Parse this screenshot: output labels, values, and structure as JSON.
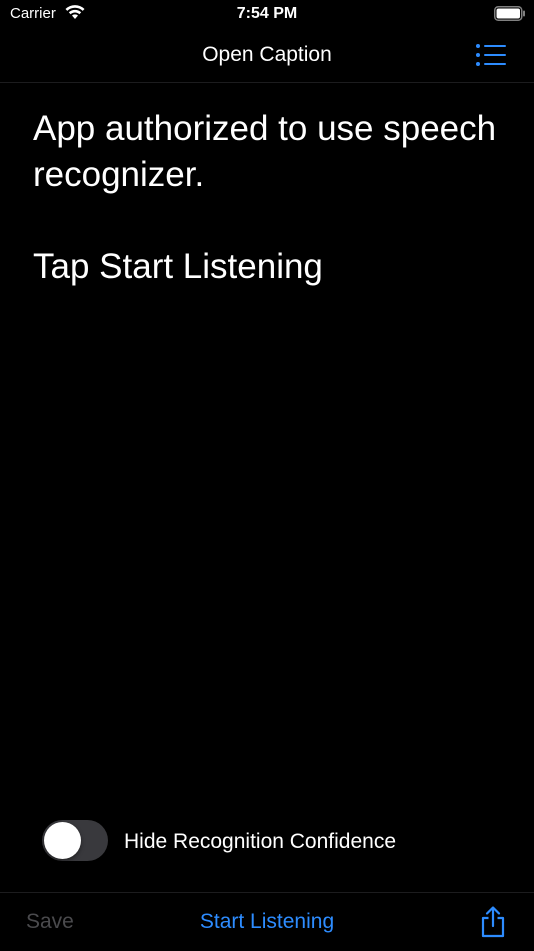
{
  "status_bar": {
    "carrier": "Carrier",
    "time": "7:54 PM"
  },
  "nav": {
    "title": "Open Caption",
    "right_icon": "list-icon"
  },
  "content": {
    "lines": [
      "App authorized to use speech recognizer.",
      "Tap Start Listening"
    ]
  },
  "toggle": {
    "label": "Hide Recognition Confidence",
    "state": "off"
  },
  "toolbar": {
    "save_label": "Save",
    "start_label": "Start Listening",
    "share_icon": "share-icon"
  },
  "colors": {
    "accent": "#2d8cff",
    "background": "#000000",
    "disabled": "#4a4a4d"
  }
}
